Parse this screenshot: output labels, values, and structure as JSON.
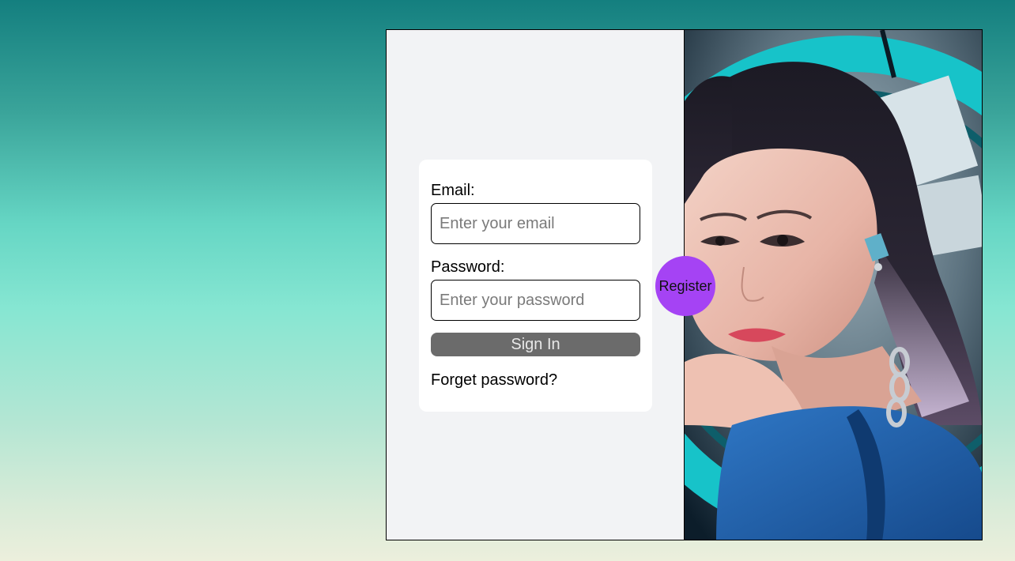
{
  "form": {
    "email_label": "Email:",
    "email_placeholder": "Enter your email",
    "email_value": "",
    "password_label": "Password:",
    "password_placeholder": "Enter your password",
    "password_value": "",
    "signin_label": "Sign In",
    "forget_label": "Forget password?"
  },
  "register": {
    "label": "Register",
    "color": "#a543f4"
  },
  "photo": {
    "subject": "portrait-photo"
  },
  "colors": {
    "signin_bg": "#6b6b6b",
    "panel_bg": "#f2f3f5",
    "card_bg": "#ffffff"
  }
}
